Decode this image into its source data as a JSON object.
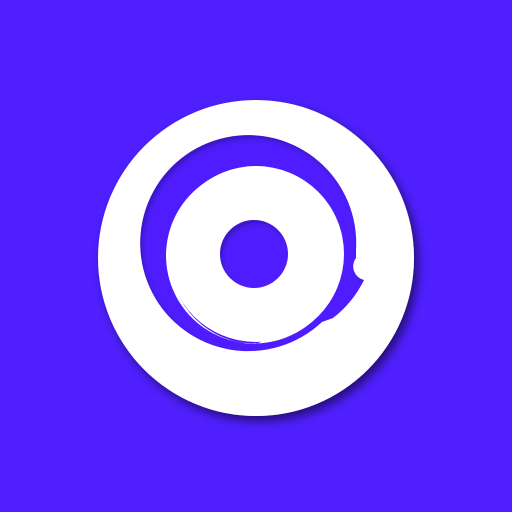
{
  "app_icon": {
    "icon": "at-sign-icon",
    "colors": {
      "background": "#4f1fff",
      "glyph": "#ffffff"
    }
  }
}
